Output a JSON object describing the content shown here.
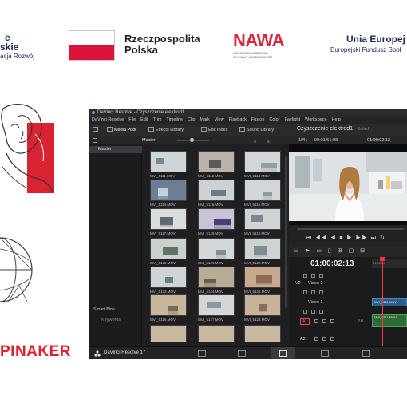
{
  "logos": {
    "fe_line1": "e",
    "fe_line2": "skie",
    "fe_line3": "acja Rozwój",
    "rp_line1": "Rzeczpospolita",
    "rp_line2": "Polska",
    "nawa_word": "NAWA",
    "nawa_sub": "NARODOWA AGENCJA WYMIANY AKADEMICKIEJ",
    "ue_line1": "Unia Europej",
    "ue_line2": "Europejski Fundusz Społ",
    "pinaker": "PINAKER"
  },
  "window": {
    "title": "DaVinci Resolve - Czyszczenie elektrod1",
    "menu": [
      "DaVinci Resolve",
      "File",
      "Edit",
      "Trim",
      "Timeline",
      "Clip",
      "Mark",
      "View",
      "Playback",
      "Fusion",
      "Color",
      "Fairlight",
      "Workspace",
      "Help"
    ],
    "toolbar": {
      "media_pool": "Media Pool",
      "effects_library": "Effects Library",
      "edit_index": "Edit Index",
      "sound_library": "Sound Library"
    },
    "viewer_title": "Czyszczenie elektrod1",
    "edited": "Edited",
    "bin_label": "Master",
    "zoom": "19%",
    "timecode_source": "00:01:51:08",
    "timecode_record": "01:00:02:13",
    "sidebar": {
      "master": "Master",
      "smart_bins": "Smart Bins",
      "keywords": "Keywords"
    },
    "clips": [
      "MVI_5111.MOV",
      "MVI_5112.MOV",
      "MVI_5113.MOV",
      "MVI_5114.MOV",
      "MVI_5115.MOV",
      "MVI_5116.MOV",
      "MVI_5117.MOV",
      "MVI_5118.MOV",
      "MVI_5119.MOV",
      "MVI_5120.MOV",
      "MVI_5121.MOV",
      "MVI_5122.MOV",
      "MVI_5123.MOV",
      "MVI_5124.MOV",
      "MVI_5125.MOV",
      "MVI_5126.MOV",
      "MVI_5127.MOV",
      "MVI_5128.MOV"
    ],
    "timeline": {
      "timecode": "01:00:02:13",
      "ruler_time": "01:00:02",
      "v2_label": "V2",
      "v2_name": "Video 2",
      "v1_name": "Video 1",
      "a1_label": "A1",
      "a2_label": "A2",
      "a1_level": "2.0",
      "clip_v1": "MVI_5111.MOV",
      "clip_a1": "MVI_5111.MOV"
    },
    "footer_app": "DaVinci Resolve 17"
  },
  "colors": {
    "resolve_bg": "#1f1f21",
    "playhead": "#ff3838",
    "video_clip": "#2d5d8a",
    "audio_clip": "#2f6b3a",
    "polish_red": "#dc143c",
    "nawa_red": "#d7263d",
    "pinaker_red": "#e0202f"
  }
}
